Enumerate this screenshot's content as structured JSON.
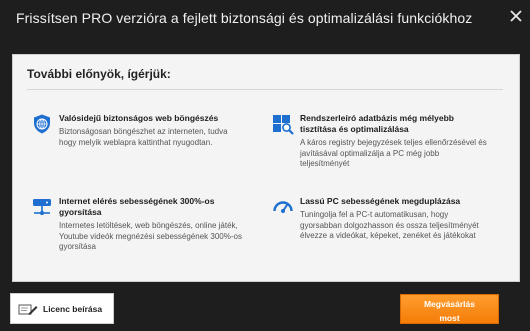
{
  "window": {
    "title": "Frissítsen PRO verzióra a fejlett biztonsági és optimalizálási funkciókhoz"
  },
  "panel": {
    "heading": "További előnyök, ígérjük:",
    "features": [
      {
        "icon": "shield-globe-icon",
        "title": "Valósidejű biztonságos web böngészés",
        "description": "Biztonságosan böngészhet az interneten, tudva hogy melyik weblapra kattinthat nyugodtan."
      },
      {
        "icon": "registry-scan-icon",
        "title": "Rendszerleíró adatbázis még mélyebb tisztítása és optimalizálása",
        "description": "A káros registry bejegyzések teljes ellenőrzésével és javításával optimalizálja a PC még jobb teljesítményét"
      },
      {
        "icon": "network-icon",
        "title": "Internet elérés sebességének 300%-os gyorsítása",
        "description": "Internetes letöltések, web böngészés, online játék, Youtube videók megnézési sebességének 300%-os gyorsítása"
      },
      {
        "icon": "speedometer-icon",
        "title": "Lassú PC sebességének megduplázása",
        "description": "Tuningolja fel a PC-t automatikusan, hogy gyorsabban dolgozhasson és ossza teljesítményét élvezze a videókat, képeket, zenéket és játékokat"
      }
    ]
  },
  "footer": {
    "license_label": "Licenc beírása",
    "upgrade_label_line1": "Megvásárlás",
    "upgrade_label_line2": "most"
  },
  "colors": {
    "accent_blue": "#1e6fd0",
    "upgrade_orange": "#f5870f"
  }
}
